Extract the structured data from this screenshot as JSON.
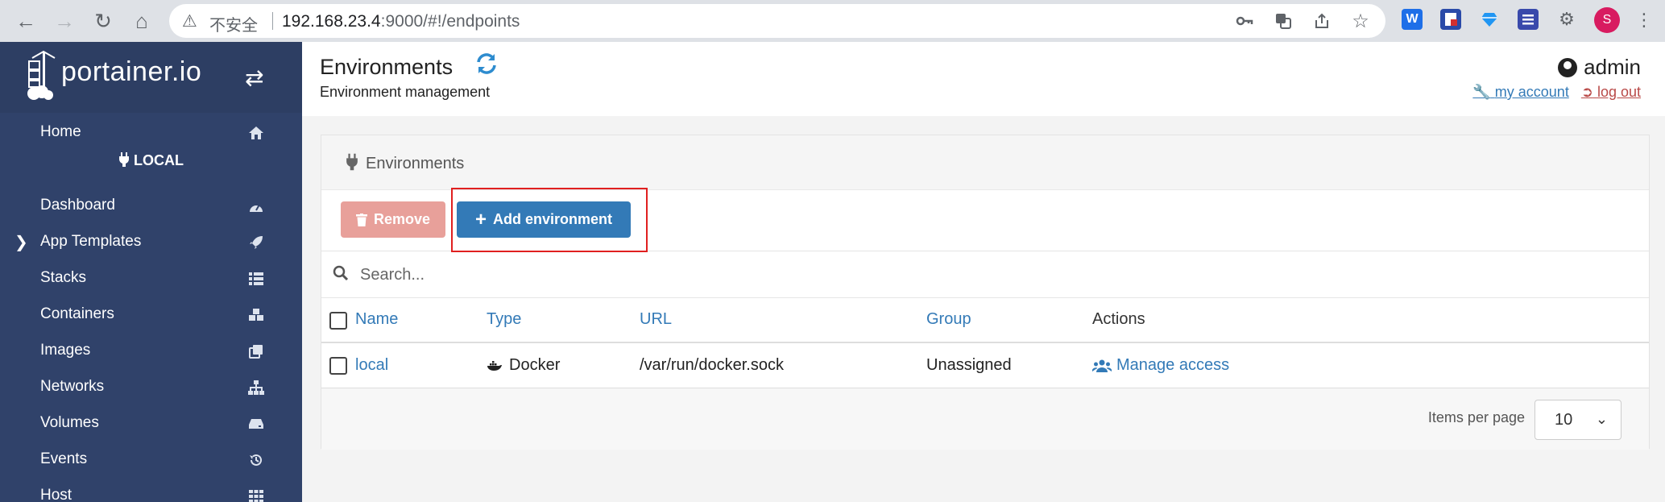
{
  "browser": {
    "insecure_label": "不安全",
    "url_host": "192.168.23.4",
    "url_rest": ":9000/#!/endpoints",
    "profile_initial": "S"
  },
  "sidebar": {
    "brand": "portainer.io",
    "home": "Home",
    "environment": "LOCAL",
    "items": [
      {
        "label": "Dashboard",
        "icon": "dashboard-icon"
      },
      {
        "label": "App Templates",
        "icon": "rocket-icon"
      },
      {
        "label": "Stacks",
        "icon": "th-list-icon"
      },
      {
        "label": "Containers",
        "icon": "cubes-icon"
      },
      {
        "label": "Images",
        "icon": "clone-icon"
      },
      {
        "label": "Networks",
        "icon": "sitemap-icon"
      },
      {
        "label": "Volumes",
        "icon": "hdd-icon"
      },
      {
        "label": "Events",
        "icon": "history-icon"
      },
      {
        "label": "Host",
        "icon": "th-icon"
      }
    ]
  },
  "header": {
    "title": "Environments",
    "subtitle": "Environment management",
    "username": "admin",
    "my_account": "my account",
    "log_out": "log out"
  },
  "panel": {
    "title": "Environments",
    "remove_label": "Remove",
    "add_label": "Add environment",
    "search_placeholder": "Search...",
    "columns": [
      "Name",
      "Type",
      "URL",
      "Group",
      "Actions"
    ],
    "rows": [
      {
        "name": "local",
        "type": "Docker",
        "url": "/var/run/docker.sock",
        "group": "Unassigned",
        "action": "Manage access"
      }
    ],
    "items_per_page_label": "Items per page",
    "items_per_page_value": "10"
  },
  "colors": {
    "sidebar": "#30426a",
    "primary": "#337ab7",
    "danger_light": "#e8a09a",
    "highlight": "#e02020"
  }
}
